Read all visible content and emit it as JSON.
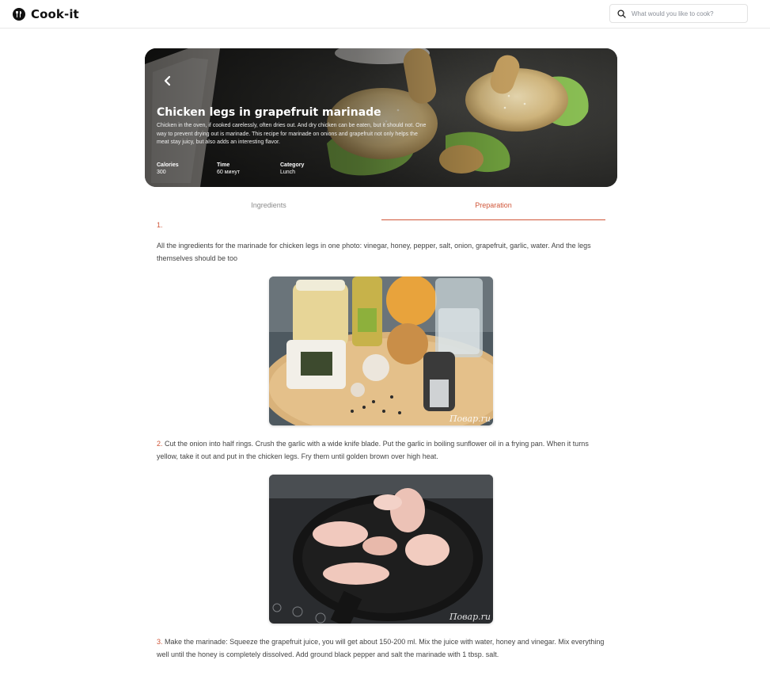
{
  "header": {
    "logo_text": "Cook-it",
    "search_placeholder": "What would you like to cook?"
  },
  "recipe": {
    "title": "Chicken legs in grapefruit marinade",
    "description": "Chicken in the oven, if cooked carelessly, often dries out. And dry chicken can be eaten, but it should not. One way to prevent drying out is marinade. This recipe for marinade on onions and grapefruit not only helps the meat stay juicy, but also adds an interesting flavor.",
    "meta": {
      "calories_label": "Calories",
      "calories_value": "300",
      "time_label": "Time",
      "time_value": "60 минут",
      "category_label": "Category",
      "category_value": "Lunch"
    }
  },
  "tabs": {
    "ingredients": "Ingredients",
    "preparation": "Preparation",
    "active": "preparation"
  },
  "steps": [
    {
      "number": "1.",
      "text": "All the ingredients for the marinade for chicken legs in one photo: vinegar, honey, pepper, salt, onion, grapefruit, garlic, water. And the legs themselves should be too",
      "photo_watermark": "Повар.ru"
    },
    {
      "number": "2.",
      "text": "Cut the onion into half rings. Crush the garlic with a wide knife blade. Put the garlic in boiling sunflower oil in a frying pan. When it turns yellow, take it out and put in the chicken legs. Fry them until golden brown over high heat.",
      "photo_watermark": "Повар.ru"
    },
    {
      "number": "3.",
      "text": "Make the marinade: Squeeze the grapefruit juice, you will get about 150-200 ml. Mix the juice with water, honey and vinegar. Mix everything well until the honey is completely dissolved. Add ground black pepper and salt the marinade with 1 tbsp. salt."
    }
  ],
  "colors": {
    "accent": "#d0573a",
    "text": "#444444",
    "muted": "#8b8b8b"
  }
}
